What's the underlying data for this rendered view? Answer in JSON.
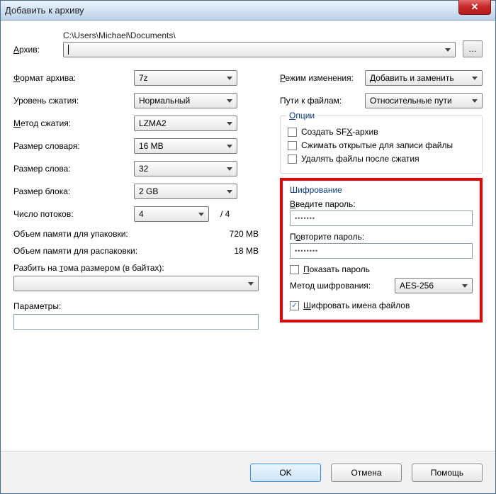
{
  "window": {
    "title": "Добавить к архиву"
  },
  "archive": {
    "label": "Архив:",
    "path": "C:\\Users\\Michael\\Documents\\",
    "value": ""
  },
  "left": {
    "format_label": "Формат архива:",
    "format_value": "7z",
    "level_label": "Уровень сжатия:",
    "level_value": "Нормальный",
    "method_label": "Метод сжатия:",
    "method_value": "LZMA2",
    "dict_label": "Размер словаря:",
    "dict_value": "16 MB",
    "word_label": "Размер слова:",
    "word_value": "32",
    "block_label": "Размер блока:",
    "block_value": "2 GB",
    "threads_label": "Число потоков:",
    "threads_value": "4",
    "threads_max": "/ 4",
    "mem_pack_label": "Объем памяти для упаковки:",
    "mem_pack_value": "720 MB",
    "mem_unpack_label": "Объем памяти для распаковки:",
    "mem_unpack_value": "18 MB",
    "split_label": "Разбить на тома размером (в байтах):",
    "split_value": "",
    "params_label": "Параметры:",
    "params_value": ""
  },
  "right": {
    "mode_label": "Режим изменения:",
    "mode_value": "Добавить и заменить",
    "paths_label": "Пути к файлам:",
    "paths_value": "Относительные пути",
    "options_title": "Опции",
    "opt_sfx": "Создать SFX-архив",
    "opt_shared": "Сжимать открытые для записи файлы",
    "opt_delete": "Удалять файлы после сжатия"
  },
  "encryption": {
    "title": "Шифрование",
    "pw_label": "Введите пароль:",
    "pw_value": "•••••••",
    "pw2_label": "Повторите пароль:",
    "pw2_value": "••••••••",
    "show_pw": "Показать пароль",
    "method_label": "Метод шифрования:",
    "method_value": "AES-256",
    "encrypt_names": "Шифровать имена файлов",
    "encrypt_names_checked": true
  },
  "buttons": {
    "ok": "OK",
    "cancel": "Отмена",
    "help": "Помощь"
  }
}
